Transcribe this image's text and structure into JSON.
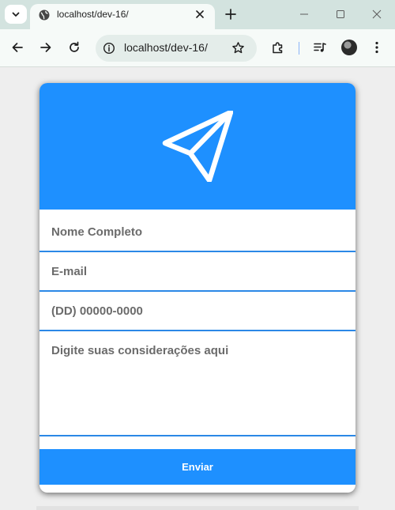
{
  "browser": {
    "tab_title": "localhost/dev-16/",
    "url": "localhost/dev-16/",
    "icons": [
      "chevron-down-icon",
      "globe-icon",
      "close-icon",
      "plus-icon",
      "minimize-icon",
      "maximize-icon",
      "close-window-icon",
      "back-icon",
      "forward-icon",
      "reload-icon",
      "info-icon",
      "star-icon",
      "extensions-icon",
      "media-icon",
      "avatar",
      "menu-icon"
    ]
  },
  "form": {
    "header_icon": "send-icon",
    "name_placeholder": "Nome Completo",
    "email_placeholder": "E-mail",
    "phone_placeholder": "(DD) 00000-0000",
    "message_placeholder": "Digite suas considerações aqui",
    "submit_label": "Enviar"
  },
  "colors": {
    "primary": "#1e90ff",
    "field_border": "#2b88e6",
    "placeholder": "#6b6b6b"
  }
}
